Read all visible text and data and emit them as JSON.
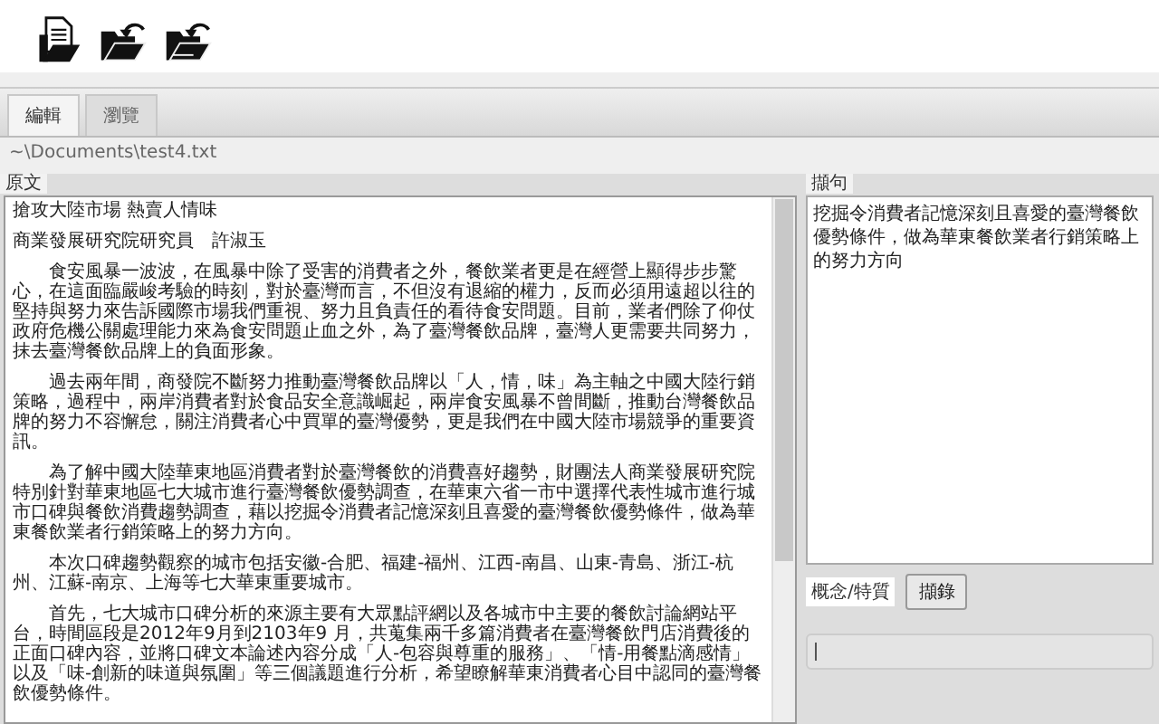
{
  "tabs": [
    {
      "label": "編輯",
      "selected": true
    },
    {
      "label": "瀏覽",
      "selected": false
    }
  ],
  "file_path": "~\\Documents\\test4.txt",
  "source_panel": {
    "label": "原文",
    "paragraphs": [
      {
        "kind": "heading",
        "text": "搶攻大陸市場 熱賣人情味"
      },
      {
        "kind": "heading",
        "text": "商業發展研究院研究員　許淑玉"
      },
      {
        "kind": "body",
        "text": "食安風暴一波波，在風暴中除了受害的消費者之外，餐飲業者更是在經營上顯得步步驚心，在這面臨嚴峻考驗的時刻，對於臺灣而言，不但沒有退縮的權力，反而必須用遠超以往的堅持與努力來告訴國際市場我們重視、努力且負責任的看待食安問題。目前，業者們除了仰仗政府危機公關處理能力來為食安問題止血之外，為了臺灣餐飲品牌，臺灣人更需要共同努力，抹去臺灣餐飲品牌上的負面形象。"
      },
      {
        "kind": "body",
        "text": "過去兩年間，商發院不斷努力推動臺灣餐飲品牌以「人，情，味」為主軸之中國大陸行銷策略，過程中，兩岸消費者對於食品安全意識崛起，兩岸食安風暴不曾間斷，推動台灣餐飲品牌的努力不容懈怠，關注消費者心中買單的臺灣優勢，更是我們在中國大陸市場競爭的重要資訊。"
      },
      {
        "kind": "body",
        "text": "為了解中國大陸華東地區消費者對於臺灣餐飲的消費喜好趨勢，財團法人商業發展研究院特別針對華東地區七大城市進行臺灣餐飲優勢調查，在華東六省一市中選擇代表性城市進行城市口碑與餐飲消費趨勢調查，藉以挖掘令消費者記憶深刻且喜愛的臺灣餐飲優勢條件，做為華東餐飲業者行銷策略上的努力方向。"
      },
      {
        "kind": "body",
        "text": "本次口碑趨勢觀察的城市包括安徽-合肥、福建-福州、江西-南昌、山東-青島、浙江-杭州、江蘇-南京、上海等七大華東重要城市。"
      },
      {
        "kind": "body",
        "text": "首先，七大城市口碑分析的來源主要有大眾點評網以及各城市中主要的餐飲討論網站平台，時間區段是2012年9月到2103年9 月，共蒐集兩千多篇消費者在臺灣餐飲門店消費後的正面口碑內容，並將口碑文本論述內容分成「人-包容與尊重的服務」、「情-用餐點滴感情」以及「味-創新的味道與氛圍」等三個議題進行分析，希望瞭解華東消費者心目中認同的臺灣餐飲優勢條件。"
      }
    ]
  },
  "excerpt_panel": {
    "label": "擷句",
    "text": "挖掘令消費者記憶深刻且喜愛的臺灣餐飲優勢條件，做為華東餐飲業者行銷策略上的努力方向"
  },
  "concept_label": "概念/特質",
  "extract_button": "擷錄"
}
